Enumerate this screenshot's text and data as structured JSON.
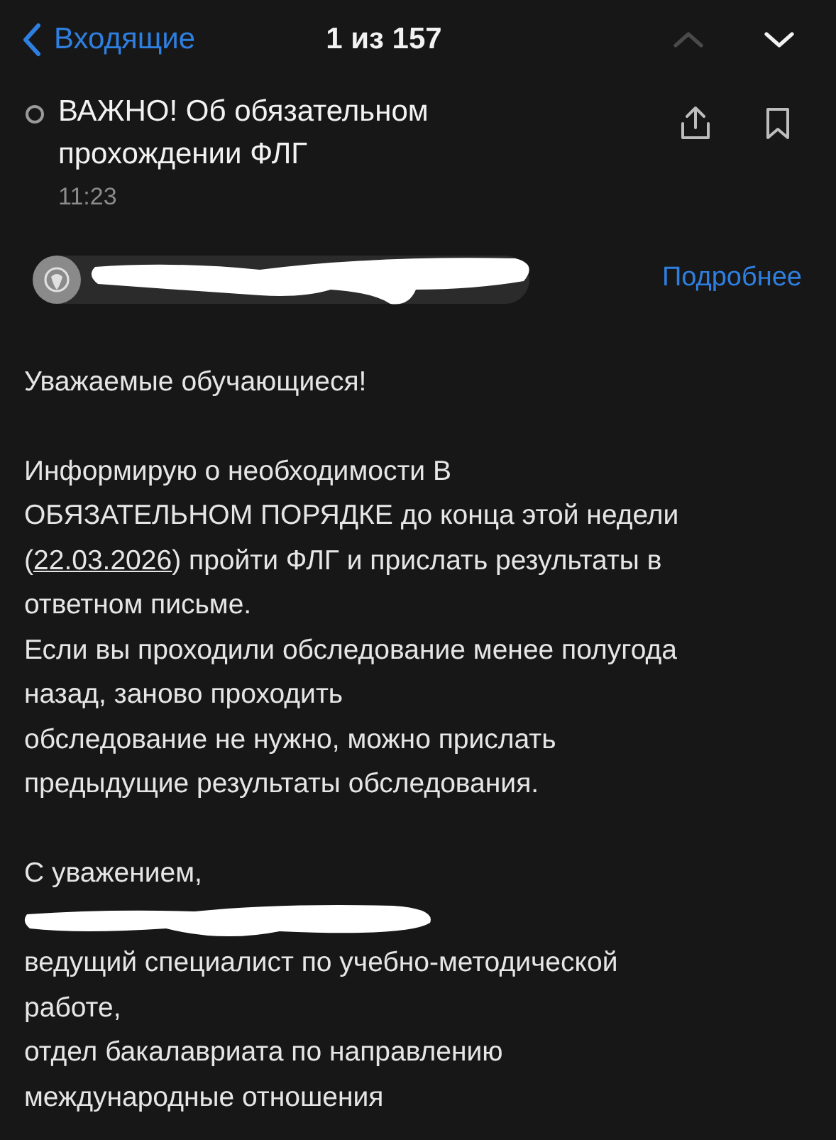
{
  "header": {
    "back_label": "Входящие",
    "position": "1 из 157",
    "prev_disabled": true,
    "next_disabled": false
  },
  "message": {
    "unread": false,
    "subject": "ВАЖНО! Об обязательном прохождении ФЛГ",
    "time": "11:23"
  },
  "sender": {
    "details_link": "Подробнее"
  },
  "body": [
    {
      "lines": [
        {
          "text": "Уважаемые обучающиеся!"
        }
      ]
    },
    {
      "lines": [
        {
          "text": "Информирую о необходимости В"
        },
        {
          "text": "ОБЯЗАТЕЛЬНОМ ПОРЯДКЕ до конца этой недели"
        },
        {
          "before": "(",
          "link": "22.03.2026",
          "text": ") пройти ФЛГ и прислать результаты в"
        },
        {
          "text": "ответном письме."
        },
        {
          "text": "Если вы проходили обследование менее полугода"
        },
        {
          "text": "назад, заново проходить"
        },
        {
          "text": "обследование не нужно, можно прислать"
        },
        {
          "text": "предыдущие результаты обследования."
        }
      ]
    },
    {
      "lines": [
        {
          "text": "С уважением,"
        },
        {
          "kind": "redacted"
        },
        {
          "text": "ведущий специалист по учебно-методической"
        },
        {
          "text": "работе,"
        },
        {
          "text": "отдел бакалавриата по направлению"
        },
        {
          "text": "международные отношения"
        }
      ]
    }
  ]
}
